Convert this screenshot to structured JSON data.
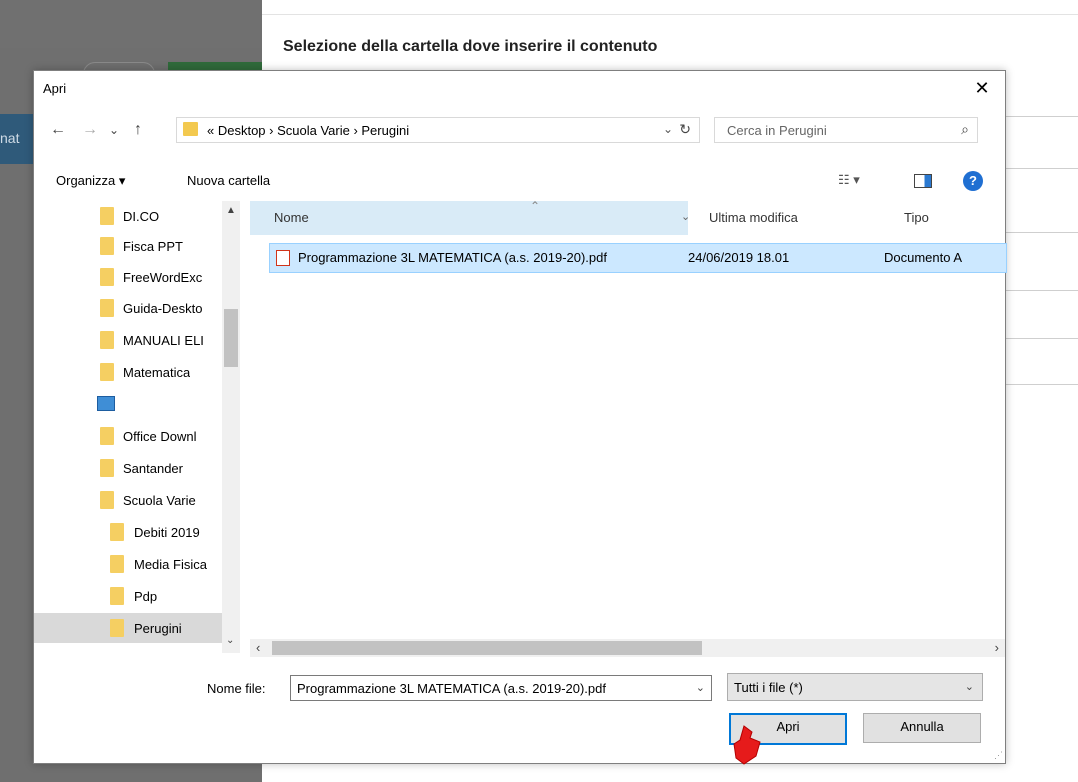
{
  "background": {
    "heading": "Selezione della cartella dove inserire il contenuto",
    "left_partial_text": "nat"
  },
  "dialog": {
    "title": "Apri",
    "close_glyph": "✕",
    "nav": {
      "back": "←",
      "forward": "→",
      "recent": "⌄",
      "up": "↑"
    },
    "address": {
      "crumbs": "« Desktop › Scuola Varie › Perugini",
      "dropdown_glyph": "⌄",
      "refresh_glyph": "↻"
    },
    "search": {
      "placeholder": "Cerca in Perugini",
      "icon": "⌕"
    },
    "toolbar": {
      "organize": "Organizza ▾",
      "new_folder": "Nuova cartella",
      "view_glyph": "☷ ▾",
      "help": "?"
    },
    "tree": [
      {
        "label": "DI.CO",
        "icon": "folder-icon",
        "indent": 0
      },
      {
        "label": "Fisca PPT",
        "icon": "folder-icon",
        "indent": 0
      },
      {
        "label": "FreeWordExc",
        "icon": "folder-icon",
        "indent": 0
      },
      {
        "label": "Guida-Deskto",
        "icon": "folder-icon",
        "indent": 0
      },
      {
        "label": "MANUALI ELI",
        "icon": "folder-icon",
        "indent": 0
      },
      {
        "label": "Matematica",
        "icon": "folder-icon",
        "indent": 0
      },
      {
        "label": "",
        "icon": "image-file-icon",
        "indent": 0
      },
      {
        "label": "Office Downl",
        "icon": "folder-icon",
        "indent": 0
      },
      {
        "label": "Santander",
        "icon": "folder-icon",
        "indent": 0
      },
      {
        "label": "Scuola Varie",
        "icon": "folder-icon",
        "indent": 0
      },
      {
        "label": "Debiti 2019",
        "icon": "folder-icon",
        "indent": 1
      },
      {
        "label": "Media Fisica",
        "icon": "folder-icon",
        "indent": 1
      },
      {
        "label": "Pdp",
        "icon": "folder-icon",
        "indent": 1
      },
      {
        "label": "Perugini",
        "icon": "folder-icon",
        "indent": 1,
        "selected": true
      }
    ],
    "columns": {
      "name": "Nome",
      "modified": "Ultima modifica",
      "type": "Tipo"
    },
    "files": [
      {
        "name": "Programmazione 3L MATEMATICA (a.s. 2019-20).pdf",
        "modified": "24/06/2019 18.01",
        "type": "Documento A"
      }
    ],
    "filename_label": "Nome file:",
    "filename_value": "Programmazione 3L MATEMATICA (a.s. 2019-20).pdf",
    "filter_value": "Tutti i file (*)",
    "open_label": "Apri",
    "cancel_label": "Annulla"
  }
}
